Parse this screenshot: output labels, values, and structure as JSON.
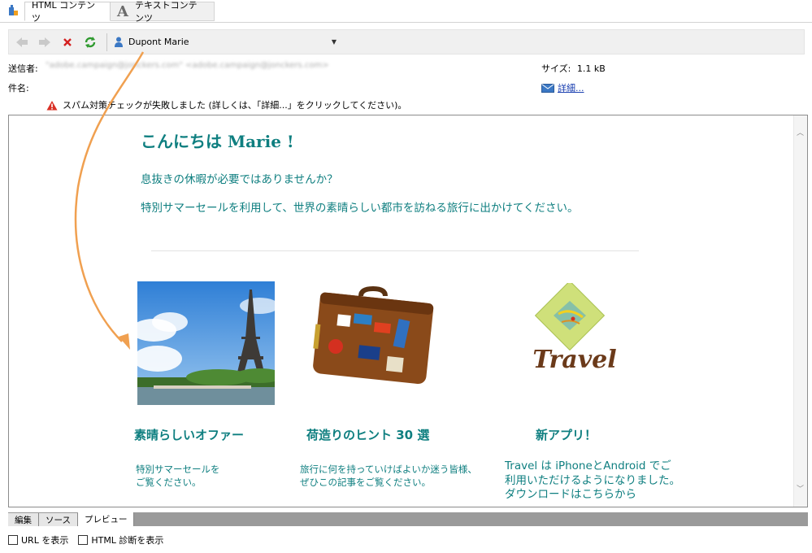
{
  "tabs": [
    {
      "label": "HTML コンテンツ",
      "active": true
    },
    {
      "label": "テキストコンテンツ",
      "active": false
    }
  ],
  "toolbar": {
    "recipient_name": "Dupont Marie"
  },
  "message": {
    "sender_label": "送信者:",
    "sender_value": "\"adobe.campaign@jonckers.com\" <adobe.campaign@jonckers.com>",
    "subject_label": "件名:",
    "size_label": "サイズ:",
    "size_value": "1.1 kB",
    "details_link": "詳細...",
    "spam_warning": "スパム対策チェックが失敗しました (詳しくは、「詳細...」をクリックしてください)。"
  },
  "preview": {
    "greeting": "こんにちは Marie !",
    "line1": "息抜きの休暇が必要ではありませんか？",
    "line2": "特別サマーセールを利用して、世界の素晴らしい都市を訪ねる旅行に出かけてください。",
    "columns": [
      {
        "title": "素晴らしいオファー",
        "desc_1": "特別サマーセールを",
        "desc_2": "ご覧ください。",
        "desc_3": ""
      },
      {
        "title": "荷造りのヒント 30 選",
        "desc_1": "旅行に何を持っていけばよいか迷う皆様、",
        "desc_2": "ぜひこの記事をご覧ください。",
        "desc_3": ""
      },
      {
        "title": "新アプリ！",
        "desc_1": "Travel は iPhoneとAndroid でご",
        "desc_2": "利用いただけるようになりました。",
        "desc_3": "ダウンロードはこちらから"
      }
    ],
    "travel_logo_text": "Travel"
  },
  "bottom_tabs": [
    {
      "label": "編集",
      "active": false
    },
    {
      "label": "ソース",
      "active": false
    },
    {
      "label": "プレビュー",
      "active": true
    }
  ],
  "options": {
    "show_url": "URL を表示",
    "show_html_diag": "HTML 診断を表示"
  },
  "colors": {
    "accent_teal": "#0f7f80",
    "annotation_arrow": "#f0a050",
    "link_blue": "#1a3fb0"
  }
}
